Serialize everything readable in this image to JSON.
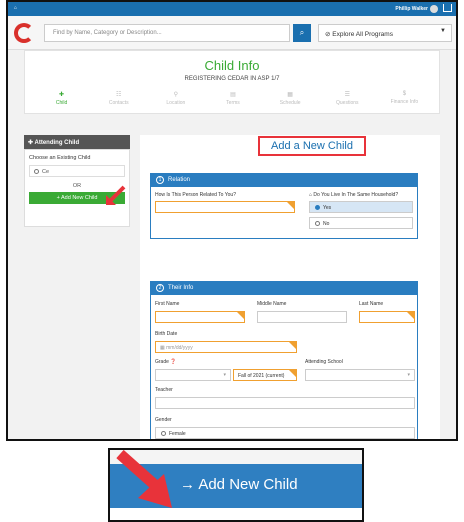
{
  "topbar": {
    "user_name": "Phillip Walker",
    "home_icon": "home-icon",
    "cart_icon": "cart-icon"
  },
  "search": {
    "placeholder": "Find by Name, Category or Description...",
    "explore_label": "Explore All Programs"
  },
  "header": {
    "title": "Child Info",
    "subtitle": "REGISTERING CEDAR IN ASP 1/7",
    "steps": [
      "Child",
      "Contacts",
      "Location",
      "Terms",
      "Schedule",
      "Questions",
      "Finance Info"
    ]
  },
  "sidebar": {
    "heading": "Attending Child",
    "choose_label": "Choose an Existing Child",
    "existing_child": "Ce",
    "or_label": "OR",
    "add_button": "+ Add New Child"
  },
  "main": {
    "add_title": "Add a New Child",
    "relation": {
      "number": "1",
      "heading": "Relation",
      "question": "How Is This Person Related To You?",
      "household_q": "Do You Live In The Same Household?",
      "options": [
        "Yes",
        "No"
      ],
      "selected": "Yes"
    },
    "info": {
      "number": "2",
      "heading": "Their Info",
      "first_name": "First Name",
      "middle_name": "Middle Name",
      "last_name": "Last Name",
      "birth_date": "Birth Date",
      "date_placeholder": "mm/dd/yyyy",
      "grade": "Grade",
      "grade_term": "Fall of 2021 (current)",
      "school": "Attending School",
      "teacher": "Teacher",
      "gender": "Gender",
      "gender_option": "Female"
    }
  },
  "zoom": {
    "label": "→ Add New Child"
  },
  "colors": {
    "brand_blue": "#2a7dc0",
    "green": "#3aaa35",
    "highlight_red": "#e8333a",
    "arrow_red": "#e8333a"
  }
}
